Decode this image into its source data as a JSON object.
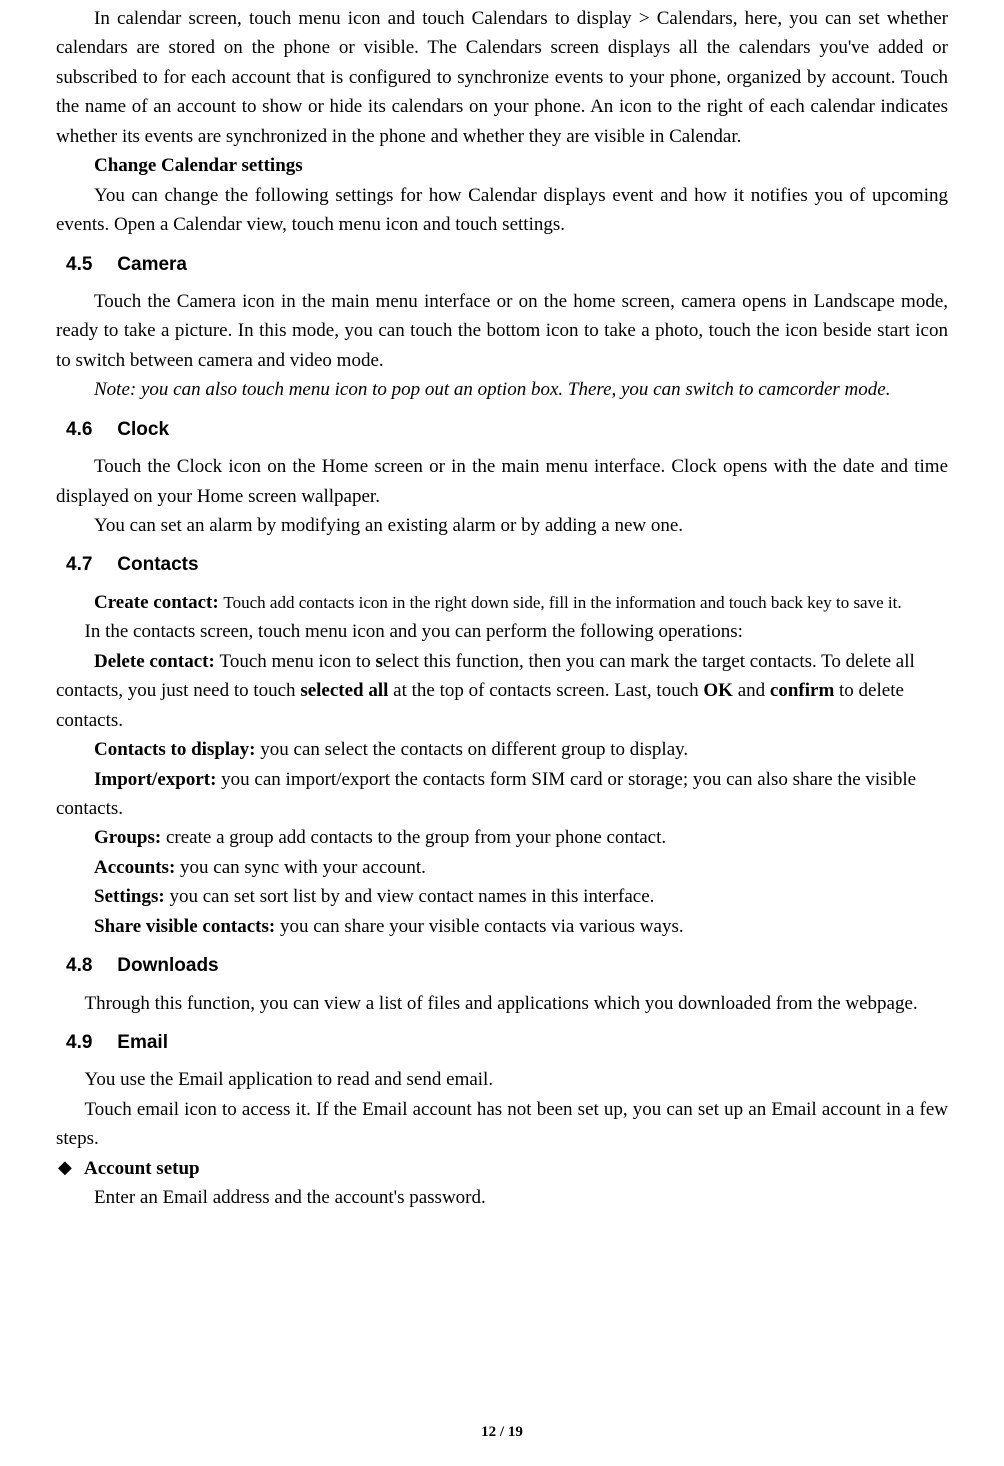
{
  "p1": "In calendar screen, touch menu icon and touch Calendars to display > Calendars, here, you can set whether calendars are stored on the phone or visible. The Calendars screen displays all the calendars you've added or subscribed to for each account that is configured to synchronize events to your phone, organized by account. Touch the name of an account to show or hide its calendars on your phone. An icon to the right of each calendar indicates whether its events are synchronized in the phone and whether they are visible in Calendar.",
  "h_change": "Change Calendar settings",
  "p2": "You can change the following settings for how Calendar displays event and how it notifies you of upcoming events. Open a Calendar view, touch menu icon and touch settings.",
  "sec45_num": "4.5",
  "sec45_title": "Camera",
  "p3": "Touch the Camera icon in the main menu interface or on the home screen, camera opens in Landscape mode, ready to take a picture. In this mode, you can touch the bottom icon to take a photo, touch the icon beside start icon to switch between camera and video mode.",
  "p4": "Note: you can also touch menu icon to pop out an option box. There, you can switch to camcorder mode.",
  "sec46_num": "4.6",
  "sec46_title": "Clock",
  "p5": "Touch the Clock icon on the Home screen or in the main menu interface. Clock opens with the date and time displayed on your Home screen wallpaper.",
  "p6": "You can set an alarm by modifying an existing alarm or by adding a new one.",
  "sec47_num": "4.7",
  "sec47_title": "Contacts",
  "p7a": "Create contact: ",
  "p7b": "Touch add contacts icon in the right down side, fill in the information and touch back key to save it.",
  "p8": "In the contacts screen, touch menu icon and you can perform the following operations:",
  "p9a": "Delete contact: ",
  "p9b": "Touch menu icon to ",
  "p9c": "s",
  "p9d": "elect this function, then you can mark the target contacts. To delete all contacts, you just need to touch ",
  "p9e": "selected all",
  "p9f": " at the top of contacts screen. Last, touch ",
  "p9g": "OK",
  "p9h": " and ",
  "p9i": "confirm",
  "p9j": " to delete contacts.",
  "p10a": "Contacts to display: ",
  "p10b": "you can select the contacts on different group to display.",
  "p11a": "Import/export: ",
  "p11b": "you can import/export the contacts form SIM card or storage; you can also share the visible contacts.",
  "p12a": "Groups: ",
  "p12b": "create a group add contacts to the group from your phone contact.",
  "p13a": "Accounts: ",
  "p13b": "you can sync with your account.",
  "p14a": "Settings: ",
  "p14b": "you can set sort list by and view contact names in this interface.",
  "p15a": "Share visible contacts: ",
  "p15b": "you can share your visible contacts via various ways.",
  "sec48_num": "4.8",
  "sec48_title": "Downloads",
  "p16": "Through this function, you can view a list of files and applications which you downloaded from the webpage.",
  "sec49_num": "4.9",
  "sec49_title": "Email",
  "p17": "You use the Email application to read and send email.",
  "p18": "Touch email icon to access it. If the Email account has not been set up, you can set up an Email account in a few steps.",
  "bullet1_label": "Account setup",
  "p19": "Enter an Email address and the account's password.",
  "footer": "12 / 19",
  "bullet_glyph": "◆"
}
